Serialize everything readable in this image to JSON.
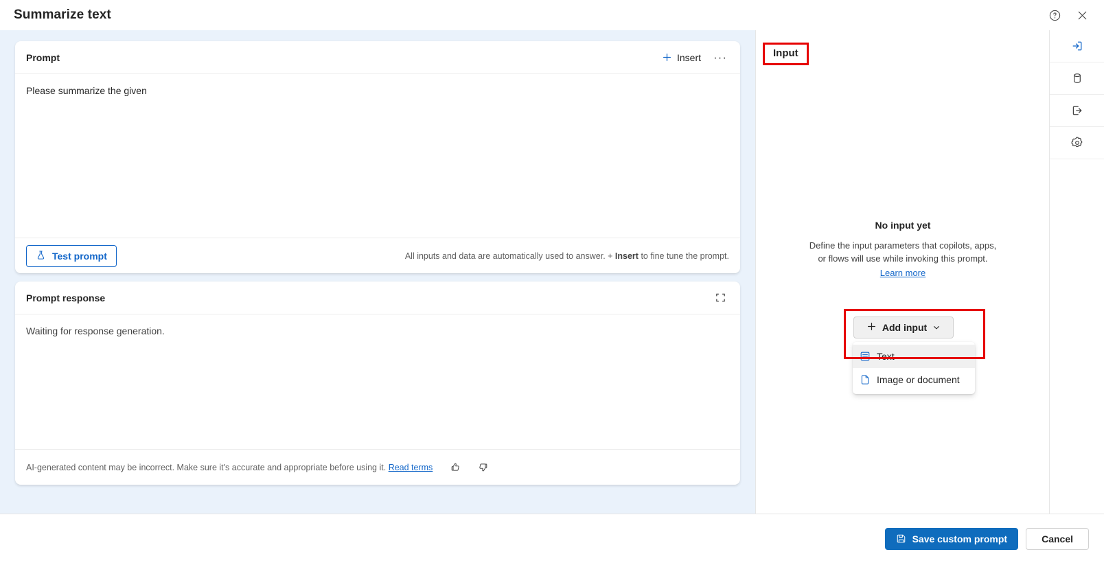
{
  "window": {
    "title": "Summarize text",
    "help_icon": "help-circle-icon",
    "close_icon": "close-icon"
  },
  "prompt_card": {
    "title": "Prompt",
    "insert_label": "Insert",
    "more_label": "···",
    "text": "Please summarize the given",
    "test_button_label": "Test prompt",
    "hint_prefix": "All inputs and data are automatically used to answer. + ",
    "hint_bold": "Insert",
    "hint_suffix": " to fine tune the prompt."
  },
  "response_card": {
    "title": "Prompt response",
    "expand_icon": "expand-icon",
    "text": "Waiting for response generation.",
    "disclaimer": "AI-generated content may be incorrect. Make sure it's accurate and appropriate before using it. ",
    "disclaimer_link": "Read terms",
    "thumbs_up_icon": "thumbs-up-icon",
    "thumbs_down_icon": "thumbs-down-icon"
  },
  "input_panel": {
    "heading": "Input",
    "empty_title": "No input yet",
    "empty_desc_line1": "Define the input parameters that copilots, apps,",
    "empty_desc_line2": "or flows will use while invoking this prompt.",
    "learn_more": "Learn more",
    "add_input_label": "Add input",
    "menu_items": [
      {
        "label": "Text",
        "icon": "text-document-icon",
        "selected": true
      },
      {
        "label": "Image or document",
        "icon": "file-icon",
        "selected": false
      }
    ]
  },
  "rail": {
    "items": [
      {
        "name": "input",
        "icon": "arrow-into-box-icon",
        "active": true
      },
      {
        "name": "data",
        "icon": "database-icon",
        "active": false
      },
      {
        "name": "output",
        "icon": "arrow-out-of-box-icon",
        "active": false
      },
      {
        "name": "settings",
        "icon": "gear-icon",
        "active": false
      }
    ]
  },
  "footer": {
    "save_label": "Save custom prompt",
    "save_icon": "save-disk-icon",
    "cancel_label": "Cancel"
  },
  "colors": {
    "accent": "#0f6cbd",
    "link": "#1266c9",
    "highlight": "#e60000",
    "canvas": "#eaf2fb"
  }
}
